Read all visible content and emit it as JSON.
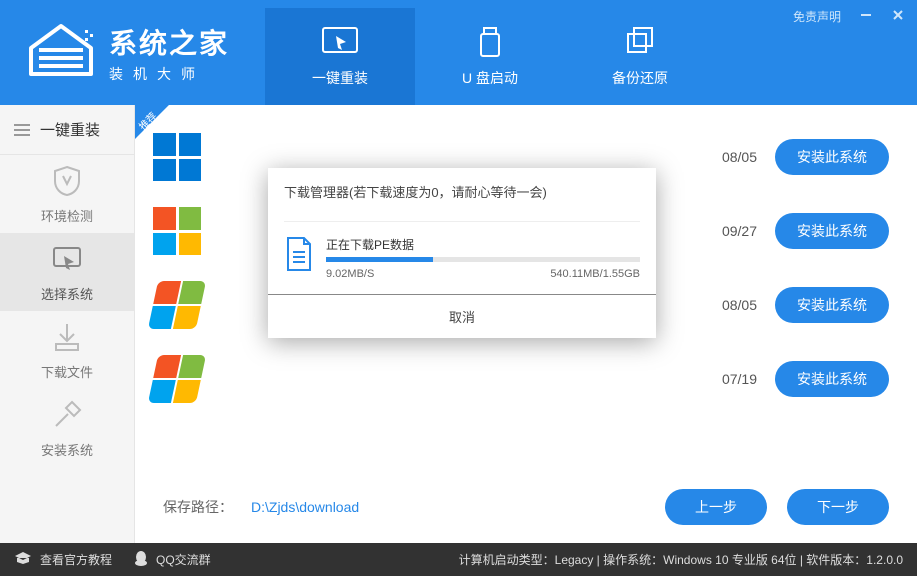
{
  "header": {
    "title": "系统之家",
    "subtitle": "装机大师",
    "disclaimer": "免责声明",
    "tabs": [
      {
        "label": "一键重装"
      },
      {
        "label": "U 盘启动"
      },
      {
        "label": "备份还原"
      }
    ]
  },
  "sidebar": {
    "top": "一键重装",
    "items": [
      {
        "label": "环境检测"
      },
      {
        "label": "选择系统"
      },
      {
        "label": "下载文件"
      },
      {
        "label": "安装系统"
      }
    ]
  },
  "ribbon": "推荐",
  "install_btn": "安装此系统",
  "rows": [
    {
      "date": "08/05"
    },
    {
      "date": "09/27"
    },
    {
      "date": "08/05"
    },
    {
      "date": "07/19"
    }
  ],
  "save": {
    "label": "保存路径：",
    "path": "D:\\Zjds\\download"
  },
  "nav": {
    "prev": "上一步",
    "next": "下一步"
  },
  "status": {
    "tutorial": "查看官方教程",
    "qq": "QQ交流群",
    "info": "计算机启动类型：Legacy | 操作系统：Windows 10 专业版 64位 | 软件版本：1.2.0.0"
  },
  "modal": {
    "title": "下载管理器(若下载速度为0，请耐心等待一会)",
    "task": "正在下载PE数据",
    "speed": "9.02MB/S",
    "size": "540.11MB/1.55GB",
    "cancel": "取消"
  }
}
